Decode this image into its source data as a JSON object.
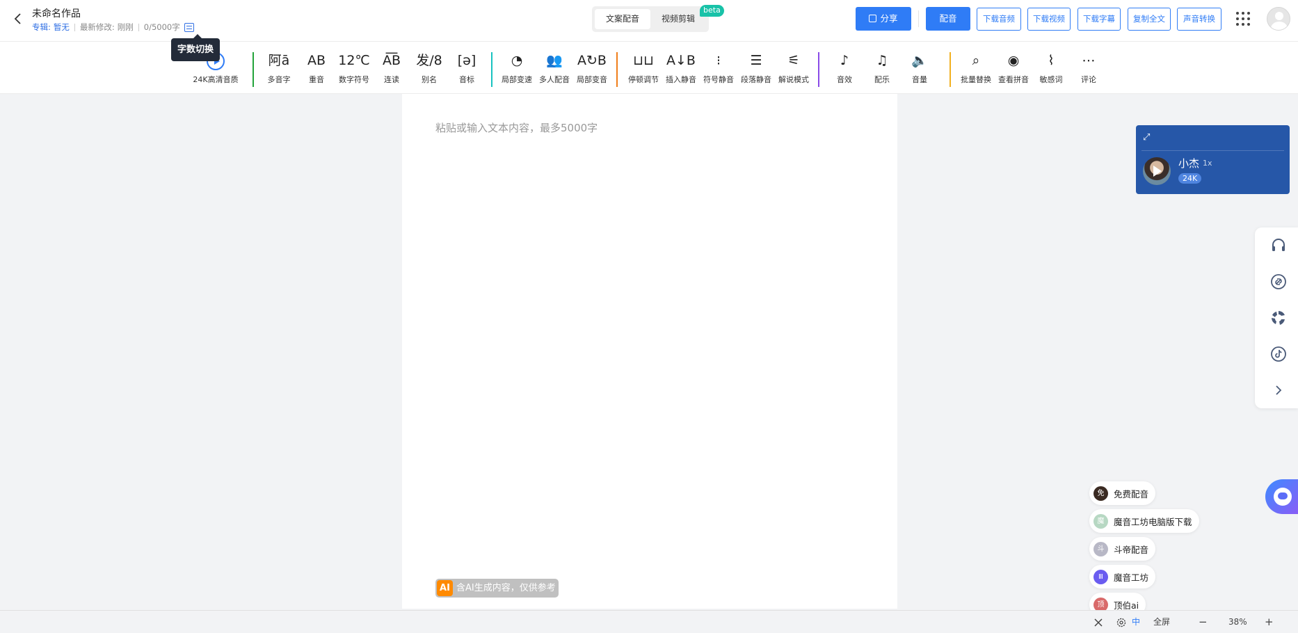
{
  "header": {
    "title": "未命名作品",
    "album_label": "专辑:",
    "album_value": "暂无",
    "modified_label": "最新修改:",
    "modified_value": "刚刚",
    "word_count": "0/5000字",
    "tooltip": "字数切换"
  },
  "modes": {
    "tabs": [
      "文案配音",
      "视频剪辑"
    ],
    "active": "文案配音",
    "badge": "beta"
  },
  "actions": {
    "share": "分享",
    "dub": "配音",
    "download_audio": "下载音频",
    "download_video": "下载视频",
    "download_subtitle": "下载字幕",
    "copy_all": "复制全文",
    "voice_convert": "声音转换"
  },
  "toolbar": {
    "hq": "24K高清音质",
    "items": [
      {
        "label": "多音字",
        "glyph": "阿ā"
      },
      {
        "label": "重音",
        "glyph": "AB"
      },
      {
        "label": "数字符号",
        "glyph": "12℃"
      },
      {
        "label": "连读",
        "glyph": "A͞B"
      },
      {
        "label": "别名",
        "glyph": "发/8"
      },
      {
        "label": "音标",
        "glyph": "[ə]"
      },
      {
        "label": "局部变速",
        "glyph": "◔"
      },
      {
        "label": "多人配音",
        "glyph": "👥"
      },
      {
        "label": "局部变音",
        "glyph": "A↻B"
      },
      {
        "label": "停顿调节",
        "glyph": "⊔⊔"
      },
      {
        "label": "插入静音",
        "glyph": "A↓B"
      },
      {
        "label": "符号静音",
        "glyph": "⁝"
      },
      {
        "label": "段落静音",
        "glyph": "☰"
      },
      {
        "label": "解说模式",
        "glyph": "⚟"
      },
      {
        "label": "音效",
        "glyph": "♪"
      },
      {
        "label": "配乐",
        "glyph": "♫"
      },
      {
        "label": "音量",
        "glyph": "🔈"
      },
      {
        "label": "批量替换",
        "glyph": "⌕"
      },
      {
        "label": "查看拼音",
        "glyph": "◉"
      },
      {
        "label": "敏感词",
        "glyph": "⌇"
      },
      {
        "label": "评论",
        "glyph": "⋯"
      }
    ],
    "separator_colors": [
      "#22a33a",
      "#18c2c0",
      "#f07e1a",
      "#8a4be8",
      "#f2b01e"
    ]
  },
  "editor": {
    "placeholder": "粘贴或输入文本内容，最多5000字",
    "ai_badge_icon": "AI",
    "ai_notice": "含AI生成内容，仅供参考"
  },
  "voice_card": {
    "name": "小杰",
    "speed": "1x",
    "quality": "24K",
    "expand_icon": "expand-icon",
    "background": "#2657a8"
  },
  "side_panel": {
    "icons": [
      "headset-icon",
      "link-icon",
      "spinner-icon",
      "tiktok-icon",
      "chevron-right-icon"
    ]
  },
  "links": [
    {
      "label": "免费配音",
      "icon": "免",
      "color": "#3a2a22"
    },
    {
      "label": "魔音工坊电脑版下载",
      "icon": "魔",
      "color": "#b7d8c3"
    },
    {
      "label": "斗帝配音",
      "icon": "斗",
      "color": "#b8b8c6"
    },
    {
      "label": "魔音工坊",
      "icon": "Ⅲ",
      "color": "#6a5cf0"
    },
    {
      "label": "顶伯ai",
      "icon": "顶",
      "color": "#d96a6a"
    }
  ],
  "statusbar": {
    "lang": "中",
    "fullscreen": "全屏",
    "zoom_minus": "−",
    "zoom": "38%",
    "zoom_plus": "+"
  },
  "colors": {
    "accent": "#2f7cf6",
    "beta": "#18c2a8",
    "ai_orange": "#ff8a00"
  }
}
